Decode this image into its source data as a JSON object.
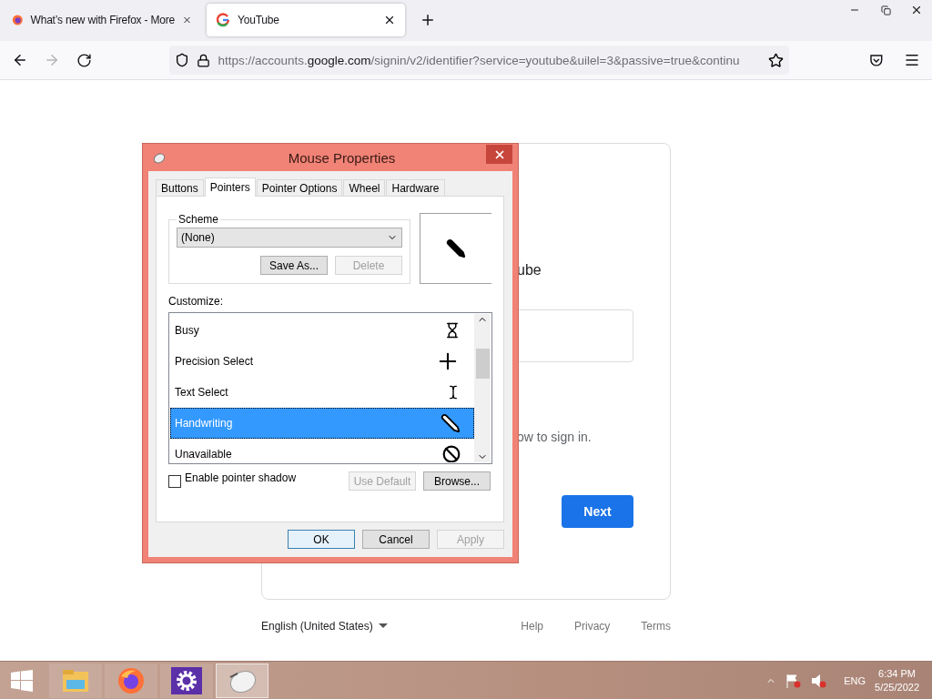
{
  "browser": {
    "tabs": [
      {
        "title": "What’s new with Firefox - More",
        "selected": false,
        "kind": "firefox"
      },
      {
        "title": "YouTube",
        "selected": true,
        "kind": "google"
      }
    ],
    "url": {
      "start": "https://accounts.",
      "host": "google.com",
      "rest": "/signin/v2/identifier?service=youtube&uilel=3&passive=true&continu"
    }
  },
  "page": {
    "heading": "ube",
    "hint": "ow to sign in.",
    "next": "Next",
    "footer": {
      "language": "English (United States)",
      "links": [
        "Help",
        "Privacy",
        "Terms"
      ]
    }
  },
  "dialog": {
    "title": "Mouse Properties",
    "tabs": [
      {
        "label": "Buttons",
        "selected": false
      },
      {
        "label": "Pointers",
        "selected": true
      },
      {
        "label": "Pointer Options",
        "selected": false
      },
      {
        "label": "Wheel",
        "selected": false
      },
      {
        "label": "Hardware",
        "selected": false
      }
    ],
    "scheme_label": "Scheme",
    "scheme_value": "(None)",
    "scheme_buttons": [
      {
        "label": "Save As...",
        "disabled": false
      },
      {
        "label": "Delete",
        "disabled": true
      }
    ],
    "customize_label": "Customize:",
    "pointers": [
      {
        "name": "Busy",
        "kind": "hourglass",
        "selected": false
      },
      {
        "name": "Precision Select",
        "kind": "crosshair",
        "selected": false
      },
      {
        "name": "Text Select",
        "kind": "ibeam",
        "selected": false
      },
      {
        "name": "Handwriting",
        "kind": "pen",
        "selected": true
      },
      {
        "name": "Unavailable",
        "kind": "no",
        "selected": false
      }
    ],
    "shadow": {
      "label": "Enable pointer shadow",
      "checked": false
    },
    "pointer_buttons": [
      {
        "label": "Use Default",
        "disabled": true
      },
      {
        "label": "Browse...",
        "disabled": false
      }
    ],
    "buttons": [
      {
        "label": "OK",
        "disabled": false,
        "default": true
      },
      {
        "label": "Cancel",
        "disabled": false,
        "default": false
      },
      {
        "label": "Apply",
        "disabled": true,
        "default": false
      }
    ]
  },
  "taskbar": {
    "apps": [
      {
        "kind": "explorer",
        "selected": false
      },
      {
        "kind": "firefox",
        "selected": false
      },
      {
        "kind": "settings",
        "selected": false
      },
      {
        "kind": "mouse",
        "selected": true
      }
    ],
    "tray": {
      "language": "ENG",
      "time": "6:34 PM",
      "date": "5/25/2022"
    }
  }
}
